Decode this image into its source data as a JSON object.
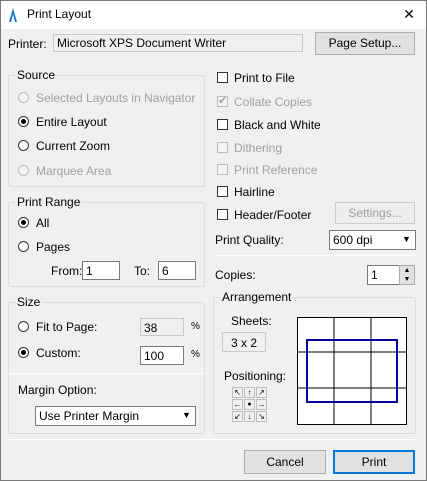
{
  "window": {
    "title": "Print Layout",
    "close": "✕"
  },
  "printer": {
    "label": "Printer:",
    "name": "Microsoft XPS Document Writer",
    "setup_button": "Page Setup..."
  },
  "source": {
    "title": "Source",
    "options": [
      "Selected Layouts in Navigator",
      "Entire Layout",
      "Current Zoom",
      "Marquee Area"
    ],
    "selected": "Entire Layout"
  },
  "print_range": {
    "title": "Print Range",
    "all_label": "All",
    "pages_label": "Pages",
    "from_label": "From:",
    "from_value": "1",
    "to_label": "To:",
    "to_value": "6",
    "selected": "All"
  },
  "size": {
    "title": "Size",
    "fit_label": "Fit to Page:",
    "fit_value": "38",
    "fit_unit": "%",
    "custom_label": "Custom:",
    "custom_value": "100",
    "custom_unit": "%",
    "selected": "Custom:"
  },
  "margin": {
    "label": "Margin Option:",
    "value": "Use Printer Margin"
  },
  "options": {
    "print_to_file": "Print to File",
    "collate_copies": "Collate Copies",
    "black_and_white": "Black and White",
    "dithering": "Dithering",
    "print_reference": "Print Reference",
    "hairline": "Hairline",
    "header_footer": "Header/Footer",
    "settings_button": "Settings...",
    "collate_checked": true
  },
  "print_quality": {
    "label": "Print Quality:",
    "value": "600 dpi"
  },
  "copies": {
    "label": "Copies:",
    "value": "1"
  },
  "arrangement": {
    "title": "Arrangement",
    "sheets_label": "Sheets:",
    "sheets_value": "3 x 2",
    "positioning_label": "Positioning:",
    "grid_cols": 3,
    "grid_rows": 3
  },
  "footer": {
    "cancel": "Cancel",
    "print": "Print"
  },
  "colors": {
    "frame_blue": "#0000a0",
    "accent": "#0078d7"
  },
  "icons": {
    "arrow_nw": "↖",
    "arrow_n": "↑",
    "arrow_ne": "↗",
    "arrow_w": "←",
    "center": "●",
    "arrow_e": "→",
    "arrow_sw": "↙",
    "arrow_s": "↓",
    "arrow_se": "↘",
    "spin_up": "▲",
    "spin_down": "▼",
    "dropdown": "▼"
  }
}
